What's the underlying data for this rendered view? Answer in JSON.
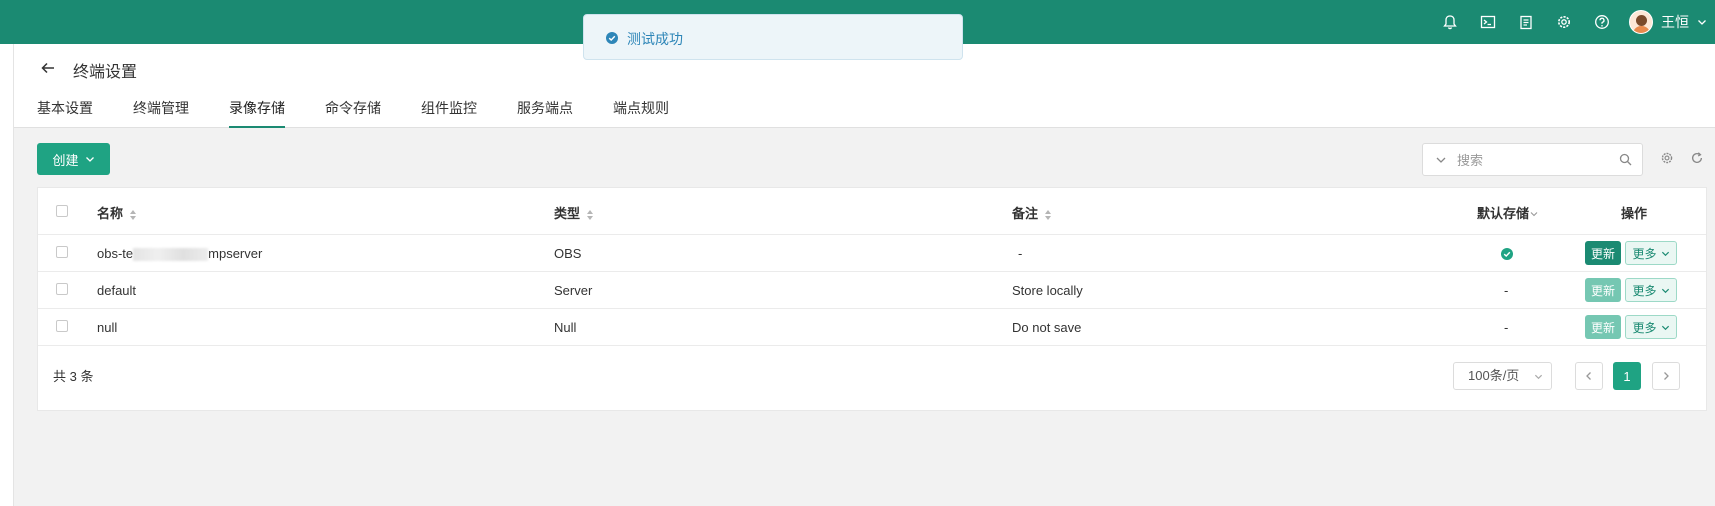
{
  "header": {
    "page_title": "终端设置",
    "user_name": "王恒",
    "icons": [
      "bell-icon",
      "terminal-icon",
      "clipboard-icon",
      "gear-icon",
      "help-icon"
    ]
  },
  "tabs": [
    {
      "label": "基本设置",
      "active": false
    },
    {
      "label": "终端管理",
      "active": false
    },
    {
      "label": "录像存储",
      "active": true
    },
    {
      "label": "命令存储",
      "active": false
    },
    {
      "label": "组件监控",
      "active": false
    },
    {
      "label": "服务端点",
      "active": false
    },
    {
      "label": "端点规则",
      "active": false
    }
  ],
  "toolbar": {
    "create_label": "创建",
    "search_placeholder": "搜索"
  },
  "table": {
    "columns": {
      "name": "名称",
      "type": "类型",
      "comment": "备注",
      "default": "默认存储",
      "actions": "操作"
    },
    "rows": [
      {
        "name_prefix": "obs-te",
        "name_suffix": "mpserver",
        "type": "OBS",
        "comment": "-",
        "default": true,
        "default_text": "",
        "update_enabled": true
      },
      {
        "name_prefix": "default",
        "name_suffix": "",
        "type": "Server",
        "comment": "Store locally",
        "default": false,
        "default_text": "-",
        "update_enabled": false
      },
      {
        "name_prefix": "null",
        "name_suffix": "",
        "type": "Null",
        "comment": "Do not save",
        "default": false,
        "default_text": "-",
        "update_enabled": false
      }
    ],
    "update_label": "更新",
    "more_label": "更多"
  },
  "pagination": {
    "total_text": "共 3 条",
    "page_size": "100条/页",
    "current_page": "1"
  },
  "toast": {
    "message": "测试成功",
    "status": "success"
  },
  "colors": {
    "brand": "#1b8a72",
    "accent": "#1fa383",
    "toast_text": "#2e86b8"
  }
}
